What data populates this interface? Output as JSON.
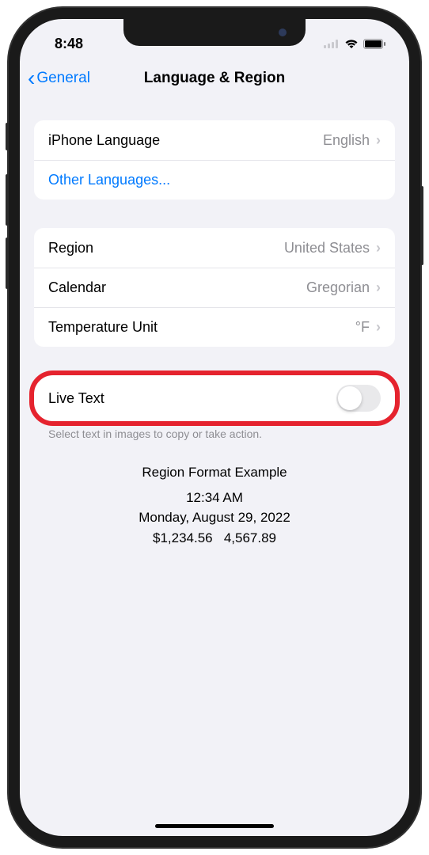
{
  "status": {
    "time": "8:48"
  },
  "nav": {
    "back_label": "General",
    "title": "Language & Region"
  },
  "group1": {
    "iphone_language": {
      "label": "iPhone Language",
      "value": "English"
    },
    "other_languages": {
      "label": "Other Languages..."
    }
  },
  "group2": {
    "region": {
      "label": "Region",
      "value": "United States"
    },
    "calendar": {
      "label": "Calendar",
      "value": "Gregorian"
    },
    "temperature": {
      "label": "Temperature Unit",
      "value": "°F"
    }
  },
  "group3": {
    "live_text": {
      "label": "Live Text",
      "footer": "Select text in images to copy or take action.",
      "enabled": false
    }
  },
  "example": {
    "title": "Region Format Example",
    "time": "12:34 AM",
    "date": "Monday, August 29, 2022",
    "currency": "$1,234.56",
    "number": "4,567.89"
  }
}
